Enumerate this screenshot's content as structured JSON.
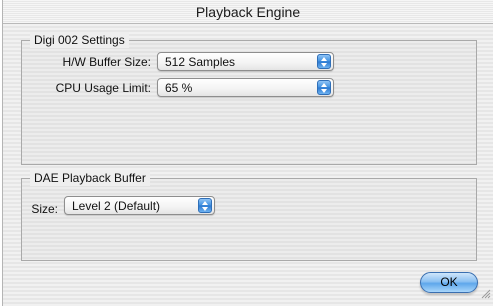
{
  "window": {
    "title": "Playback Engine"
  },
  "digi_group": {
    "label": "Digi 002 Settings",
    "hw_buffer": {
      "label": "H/W Buffer Size:",
      "value": "512 Samples"
    },
    "cpu_limit": {
      "label": "CPU Usage Limit:",
      "value": "65 %"
    }
  },
  "dae_group": {
    "label": "DAE Playback Buffer",
    "size": {
      "label": "Size:",
      "value": "Level 2 (Default)"
    }
  },
  "ok_label": "OK",
  "icons": {
    "popup": "up-down-arrows-icon",
    "grip": "resize-grip-icon"
  },
  "colors": {
    "accent": "#3d8fe0"
  }
}
